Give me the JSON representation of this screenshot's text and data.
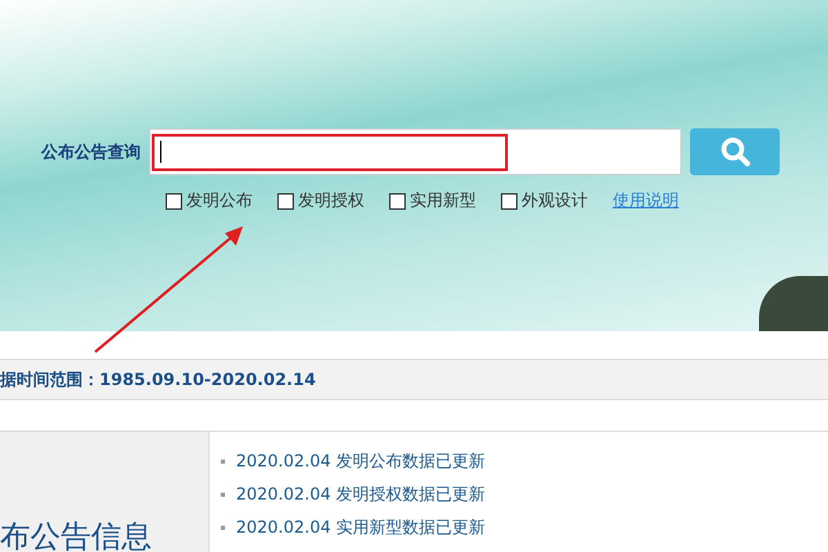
{
  "search": {
    "label": "公布公告查询"
  },
  "filters": [
    {
      "label": "发明公布",
      "checked": false
    },
    {
      "label": "发明授权",
      "checked": false
    },
    {
      "label": "实用新型",
      "checked": false
    },
    {
      "label": "外观设计",
      "checked": false
    }
  ],
  "help_link": "使用说明",
  "date_range": "据时间范围：1985.09.10-2020.02.14",
  "side_title": "布公告信息",
  "news": [
    {
      "text": "2020.02.04 发明公布数据已更新"
    },
    {
      "text": "2020.02.04 发明授权数据已更新"
    },
    {
      "text": "2020.02.04 实用新型数据已更新"
    }
  ]
}
